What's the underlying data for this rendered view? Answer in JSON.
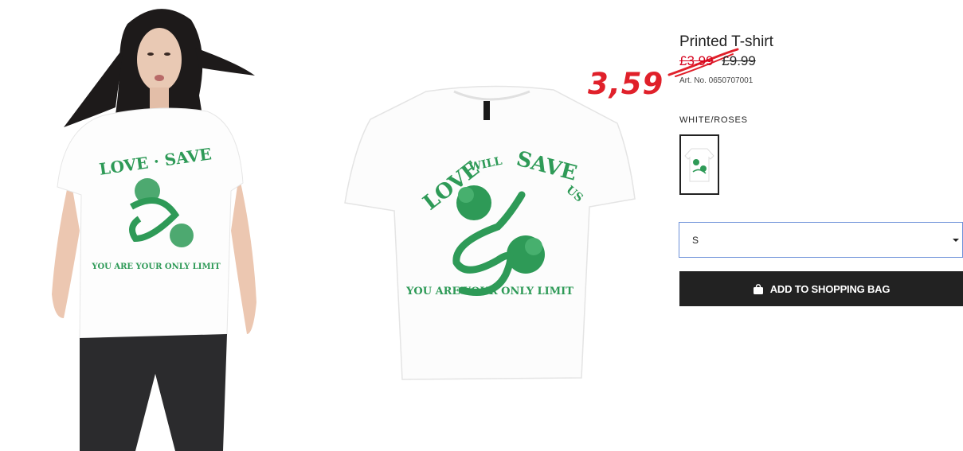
{
  "product": {
    "title": "Printed T-shirt",
    "price_current": "£3.99",
    "price_original": "£9.99",
    "article_number": "Art. No. 0650707001",
    "color_name": "WHITE/ROSES",
    "selected_size": "S",
    "add_to_bag_label": "ADD TO SHOPPING BAG"
  },
  "annotation": {
    "handwritten_price": "3,59",
    "color": "#e0202a"
  },
  "print": {
    "line1_word1": "LOVE",
    "line1_word2": "WILL",
    "line1_word3": "SAVE",
    "line1_word4": "US",
    "line2": "YOU ARE YOUR ONLY LIMIT",
    "color": "#2e9a57"
  },
  "icons": {
    "bag": "shopping-bag-icon",
    "dropdown": "chevron-down-icon"
  }
}
